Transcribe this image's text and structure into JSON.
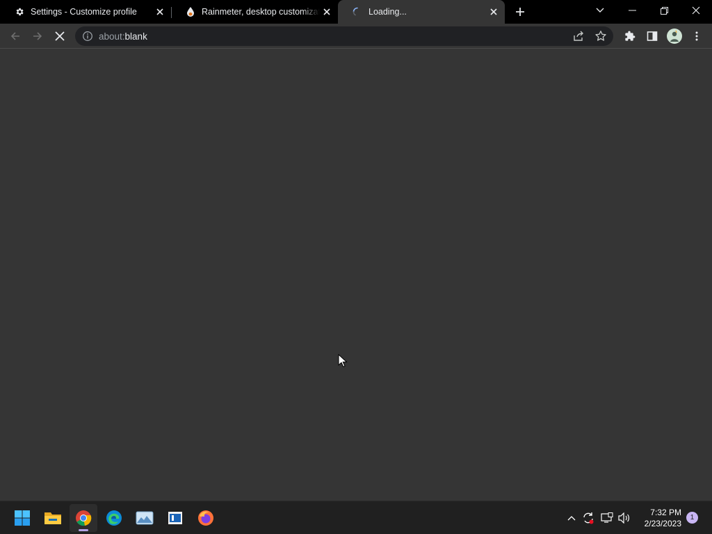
{
  "tabs": [
    {
      "title": "Settings - Customize profile",
      "icon": "gear-icon"
    },
    {
      "title": "Rainmeter, desktop customization tool",
      "icon": "rainmeter-drop-icon"
    },
    {
      "title": "Loading...",
      "icon": "loading-spinner-icon"
    }
  ],
  "toolbar": {
    "url_scheme": "about:",
    "url_host": "blank"
  },
  "taskbar": {
    "apps": [
      "windows-start-icon",
      "file-explorer-icon",
      "chrome-icon",
      "edge-icon",
      "photos-icon",
      "news-app-icon",
      "firefox-icon"
    ],
    "active_app": "chrome-icon",
    "time": "7:32 PM",
    "date": "2/23/2023",
    "notification_count": "1"
  },
  "colors": {
    "tabstrip_bg": "#000000",
    "toolbar_bg": "#353535",
    "omnibox_bg": "#202124",
    "page_bg": "#353535",
    "taskbar_bg": "#202020",
    "accent": "#b3a2e6"
  }
}
